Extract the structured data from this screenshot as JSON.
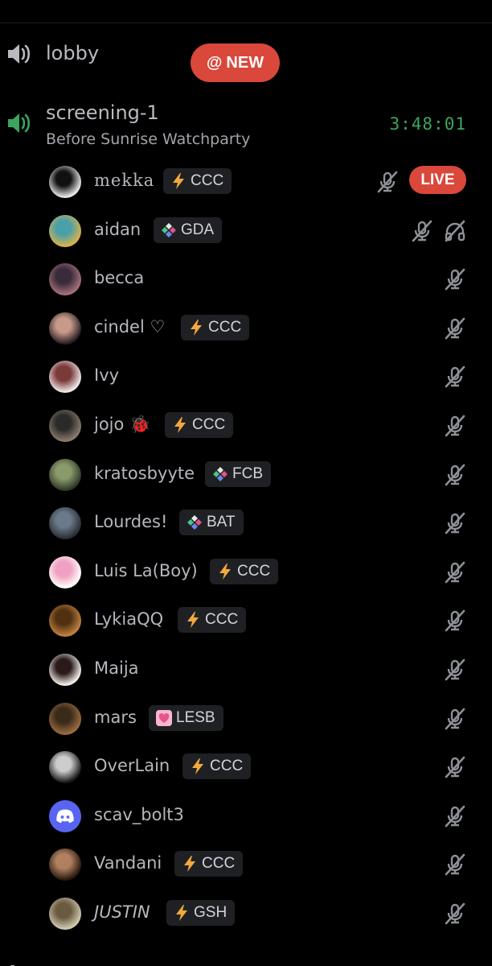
{
  "channels": {
    "lobby": {
      "name": "lobby"
    },
    "screening": {
      "name": "screening-1",
      "subtitle": "Before Sunrise Watchparty",
      "elapsed": "3:48:01"
    }
  },
  "new_badge": {
    "at": "@",
    "label": "NEW"
  },
  "live_label": "LIVE",
  "colors": {
    "background": "#000000",
    "live_red": "#d9483b",
    "voice_green": "#3ba55d",
    "tag_bg": "#1f2024",
    "discord_blurple": "#5865f2"
  },
  "users": [
    {
      "name": "mekka",
      "tag": "CCC",
      "tag_icon": "lightning-icon",
      "status": [
        "mic-muted-icon"
      ],
      "live": true
    },
    {
      "name": "aidan",
      "tag": "GDA",
      "tag_icon": "diamond-cluster-icon",
      "status": [
        "mic-muted-icon",
        "headphones-deafened-icon"
      ]
    },
    {
      "name": "becca",
      "status": [
        "mic-muted-icon"
      ]
    },
    {
      "name": "cindel ♡",
      "tag": "CCC",
      "tag_icon": "lightning-icon",
      "status": [
        "mic-muted-icon"
      ]
    },
    {
      "name": "Ivy",
      "status": [
        "mic-muted-icon"
      ]
    },
    {
      "name": "jojo 🐞",
      "tag": "CCC",
      "tag_icon": "lightning-icon",
      "status": [
        "mic-muted-icon"
      ]
    },
    {
      "name": "kratosbyyte",
      "tag": "FCB",
      "tag_icon": "diamond-cluster-icon",
      "status": [
        "mic-muted-icon"
      ]
    },
    {
      "name": "Lourdes!",
      "tag": "BAT",
      "tag_icon": "diamond-cluster-icon",
      "status": [
        "mic-muted-icon"
      ]
    },
    {
      "name": "Luis La(Boy)",
      "tag": "CCC",
      "tag_icon": "lightning-icon",
      "status": [
        "mic-muted-icon"
      ]
    },
    {
      "name": "LykiaQQ",
      "tag": "CCC",
      "tag_icon": "lightning-icon",
      "status": [
        "mic-muted-icon"
      ]
    },
    {
      "name": "Maija",
      "status": [
        "mic-muted-icon"
      ]
    },
    {
      "name": "mars",
      "tag": "LESB",
      "tag_icon": "pink-heart-icon",
      "status": [
        "mic-muted-icon"
      ]
    },
    {
      "name": "OverLain",
      "tag": "CCC",
      "tag_icon": "lightning-icon",
      "status": [
        "mic-muted-icon"
      ]
    },
    {
      "name": "scav_bolt3",
      "status": [
        "mic-muted-icon"
      ],
      "avatar_icon": "discord-logo-icon"
    },
    {
      "name": "Vandani",
      "tag": "CCC",
      "tag_icon": "lightning-icon",
      "status": [
        "mic-muted-icon"
      ]
    },
    {
      "name": "JUSTIN",
      "tag": "GSH",
      "tag_icon": "lightning-icon",
      "status": [
        "mic-muted-icon"
      ]
    }
  ]
}
